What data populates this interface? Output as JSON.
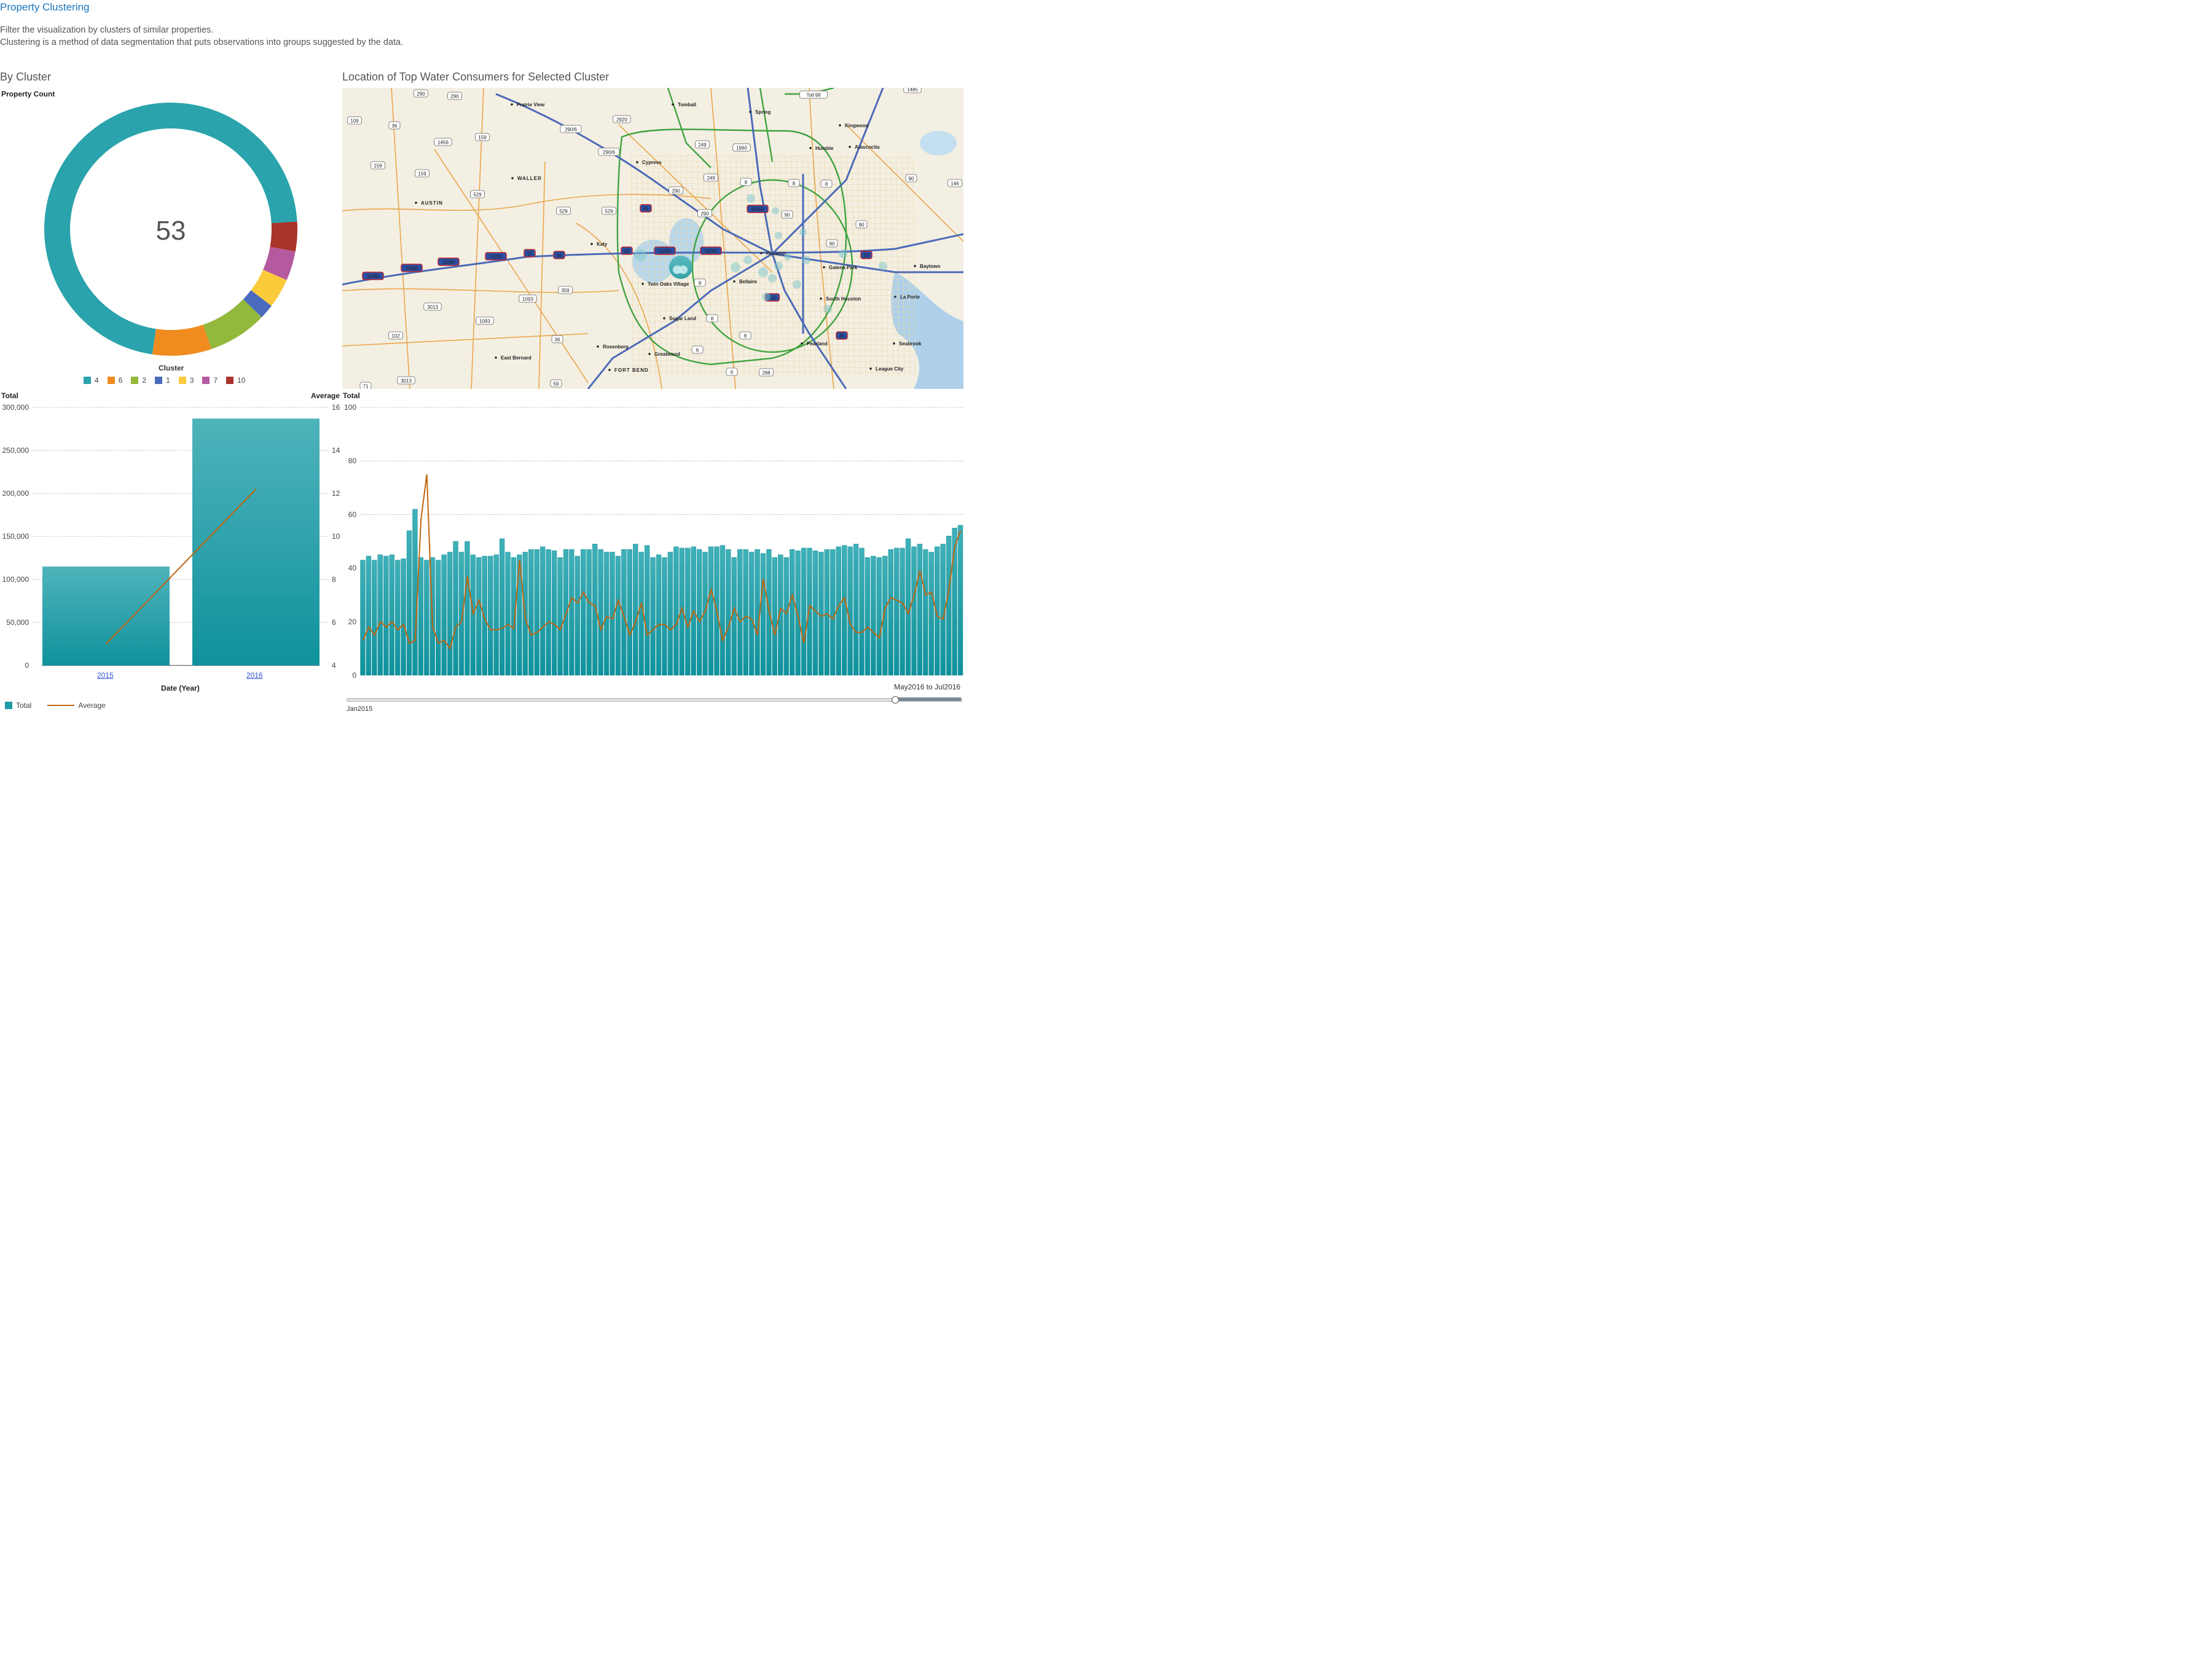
{
  "header": {
    "title": "Property Clustering",
    "line1": "Filter the visualization by clusters of similar properties.",
    "line2": "Clustering is a method of data segmentation that puts observations into groups suggested by the data."
  },
  "donut": {
    "section_title": "By Cluster",
    "measure_label": "Property Count",
    "center_value": "53",
    "legend_title": "Cluster"
  },
  "map": {
    "section_title": "Location of Top Water Consumers for Selected Cluster",
    "colors": {
      "water": "#aed0ea",
      "land": "#f4efe3",
      "highway": "#4a6ab8",
      "arterial": "#e9a64a",
      "beltway": "#3fa33f"
    },
    "places": [
      "Prairie View",
      "Tomball",
      "Spring",
      "Kingwood",
      "Humble",
      "Atascocita",
      "Cypress",
      "WALLER",
      "AUSTIN",
      "Katy",
      "Houston",
      "Galena Park",
      "Baytown",
      "Bellaire",
      "Twin Oaks Village",
      "South Houston",
      "La Porte",
      "Sugar Land",
      "Pearland",
      "Seabrook",
      "Rosenberg",
      "Greatwood",
      "East Bernard",
      "FORT BEND",
      "League City"
    ],
    "shields": [
      "290",
      "290",
      "Toll 99",
      "1485",
      "109",
      "36",
      "2920",
      "290/6",
      "1960",
      "1456",
      "159",
      "249",
      "290/6",
      "159",
      "159",
      "1960",
      "8",
      "8",
      "8",
      "529",
      "249",
      "90",
      "146",
      "290",
      "529",
      "529",
      "45",
      "69/59",
      "90",
      "290",
      "90",
      "90",
      "10/90",
      "10/90",
      "10/90",
      "10",
      "10",
      "10/90",
      "10/90",
      "10/90",
      "10",
      "10",
      "10",
      "8",
      "359",
      "610",
      "1093",
      "3013",
      "1093",
      "8",
      "45",
      "102",
      "36",
      "8",
      "6",
      "6",
      "288",
      "71",
      "3013",
      "59"
    ]
  },
  "bar_chart": {
    "left_axis_title": "Total",
    "right_axis_title": "Average",
    "left_ticks": [
      "300,000",
      "250,000",
      "200,000",
      "150,000",
      "100,000",
      "50,000",
      "0"
    ],
    "right_ticks": [
      "16",
      "14",
      "12",
      "10",
      "8",
      "6",
      "4"
    ],
    "x_title": "Date (Year)",
    "legend_total": "Total",
    "legend_average": "Average"
  },
  "ts_chart": {
    "axis_title": "Total",
    "ticks": [
      "100",
      "80",
      "60",
      "40",
      "20",
      "0"
    ],
    "range_label": "May2016 to Jul2016",
    "start_label": "Jan2015"
  },
  "chart_data": [
    {
      "type": "pie",
      "title": "By Cluster",
      "center_value": 53,
      "categories": [
        "4",
        "6",
        "2",
        "1",
        "3",
        "7",
        "10"
      ],
      "values": [
        38,
        4,
        4,
        1,
        2,
        2,
        2
      ],
      "colors": [
        "#2aa3ac",
        "#f08c1f",
        "#92b83c",
        "#4a6bbd",
        "#fbcb3b",
        "#b55aa0",
        "#a8342a"
      ]
    },
    {
      "type": "bar",
      "title": "",
      "categories": [
        "2015",
        "2016"
      ],
      "series": [
        {
          "name": "Total",
          "values": [
            115000,
            287000
          ],
          "axis": "left"
        },
        {
          "name": "Average",
          "values": [
            5.0,
            12.2
          ],
          "axis": "right",
          "render": "line"
        }
      ],
      "xlabel": "Date (Year)",
      "ylabel": "Total",
      "y2label": "Average",
      "ylim": [
        0,
        300000
      ],
      "y2lim": [
        4,
        16
      ]
    },
    {
      "type": "bar",
      "title": "",
      "ylabel": "Total",
      "ylim": [
        0,
        100
      ],
      "x_start": "Jan2015",
      "series": [
        {
          "name": "Total",
          "values": [
            43,
            44.5,
            43,
            45,
            44.5,
            45,
            43,
            43.5,
            54,
            62,
            44,
            43,
            44,
            43,
            45,
            46,
            50,
            46,
            50,
            45,
            44,
            44.5,
            44.5,
            45,
            51,
            46,
            44,
            45,
            46,
            47,
            47,
            48,
            47,
            46.5,
            44,
            47,
            47,
            44.5,
            47,
            47,
            49,
            47,
            46,
            46,
            44.5,
            47,
            47,
            49,
            46,
            48.5,
            44,
            45,
            44,
            46,
            48,
            47.5,
            47.5,
            48,
            47,
            46,
            48,
            48,
            48.5,
            47,
            44,
            47,
            47,
            46,
            47,
            45.5,
            47,
            44,
            45,
            44,
            47,
            46.5,
            47.5,
            47.5,
            46.5,
            46,
            47,
            47,
            48,
            48.5,
            48,
            49,
            47.5,
            44,
            44.5,
            44,
            44.5,
            47,
            47.5,
            47.5,
            51,
            48,
            49,
            47,
            46,
            48,
            49,
            52,
            55,
            56
          ]
        },
        {
          "name": "Average",
          "render": "line",
          "values": [
            13,
            18,
            15,
            20,
            18,
            20,
            17,
            19,
            12,
            13,
            58,
            75,
            18,
            12,
            13,
            10,
            18,
            20,
            37,
            23,
            28,
            21,
            17,
            17,
            17.5,
            19,
            17.5,
            43,
            21,
            15,
            16,
            18,
            20,
            19,
            17,
            23,
            29,
            27,
            31,
            27,
            26,
            17,
            22,
            21,
            28,
            22,
            15,
            20,
            27,
            15,
            17,
            19,
            19,
            17,
            19,
            25,
            18,
            24,
            20,
            24,
            32,
            24,
            13,
            18,
            25,
            20,
            22,
            21,
            15,
            36,
            24,
            15,
            25,
            23,
            30,
            22,
            12,
            26,
            24,
            22,
            23,
            21,
            26,
            29,
            19,
            16,
            16,
            18,
            16,
            14,
            25,
            29,
            28,
            27,
            23,
            30,
            39,
            30,
            31,
            22,
            21,
            32,
            48,
            54
          ]
        }
      ]
    }
  ]
}
